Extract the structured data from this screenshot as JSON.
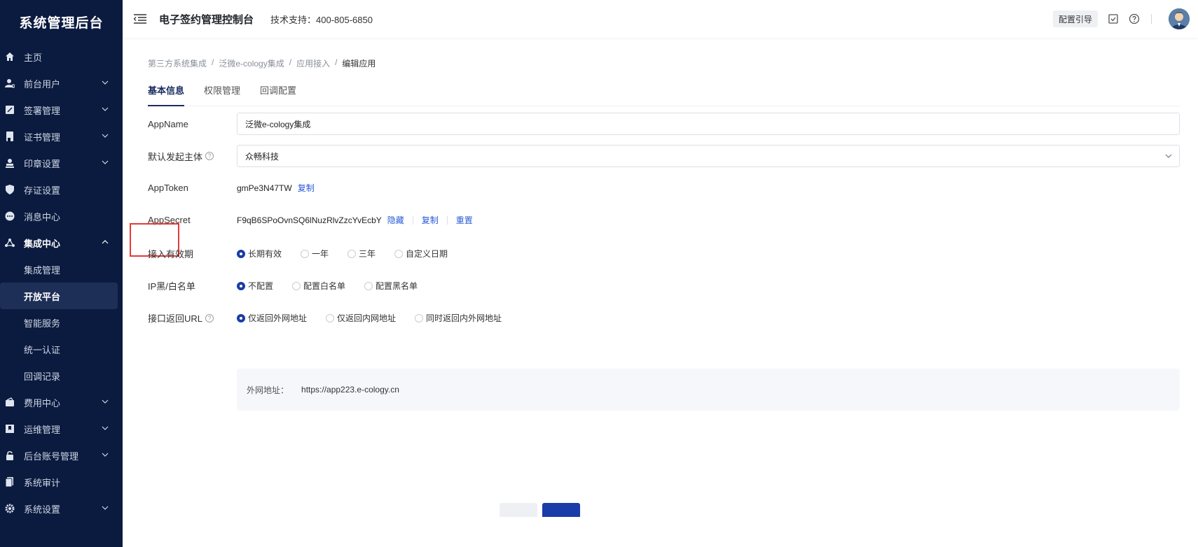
{
  "sidebar": {
    "brand": "系统管理后台",
    "items": [
      {
        "label": "主页"
      },
      {
        "label": "前台用户"
      },
      {
        "label": "签署管理"
      },
      {
        "label": "证书管理"
      },
      {
        "label": "印章设置"
      },
      {
        "label": "存证设置"
      },
      {
        "label": "消息中心"
      },
      {
        "label": "集成中心"
      },
      {
        "label": "费用中心"
      },
      {
        "label": "运维管理"
      },
      {
        "label": "后台账号管理"
      },
      {
        "label": "系统审计"
      },
      {
        "label": "系统设置"
      }
    ],
    "sub_items": [
      {
        "label": "集成管理"
      },
      {
        "label": "开放平台"
      },
      {
        "label": "智能服务"
      },
      {
        "label": "统一认证"
      },
      {
        "label": "回调记录"
      }
    ]
  },
  "header": {
    "title": "电子签约管理控制台",
    "support": "技术支持：400-805-6850",
    "guide_label": "配置引导"
  },
  "breadcrumb": [
    "第三方系统集成",
    "泛微e-cology集成",
    "应用接入",
    "编辑应用"
  ],
  "tabs": [
    {
      "label": "基本信息"
    },
    {
      "label": "权限管理"
    },
    {
      "label": "回调配置"
    }
  ],
  "form": {
    "app_name": {
      "label": "AppName",
      "value": "泛微e-cology集成"
    },
    "issuer": {
      "label": "默认发起主体",
      "value": "众畅科技"
    },
    "app_token": {
      "label": "AppToken",
      "value": "gmPe3N47TW",
      "copy": "复制"
    },
    "app_secret": {
      "label": "AppSecret",
      "value": "F9qB6SPoOvnSQ6lNuzRlvZzcYvEcbY",
      "hide": "隐藏",
      "copy": "复制",
      "reset": "重置"
    },
    "validity": {
      "label": "接入有效期",
      "options": [
        "长期有效",
        "一年",
        "三年",
        "自定义日期"
      ],
      "selected": 0
    },
    "ip_list": {
      "label": "IP黑/白名单",
      "options": [
        "不配置",
        "配置白名单",
        "配置黑名单"
      ],
      "selected": 0
    },
    "return_url": {
      "label": "接口返回URL",
      "options": [
        "仅返回外网地址",
        "仅返回内网地址",
        "同时返回内外网地址"
      ],
      "selected": 0
    },
    "external": {
      "key": "外网地址：",
      "value": "https://app223.e-cology.cn"
    }
  },
  "colors": {
    "sidebar_bg": "#0b1b3f",
    "primary": "#1a3ca8",
    "link": "#2a5bd7",
    "highlight": "#e23b3b"
  }
}
